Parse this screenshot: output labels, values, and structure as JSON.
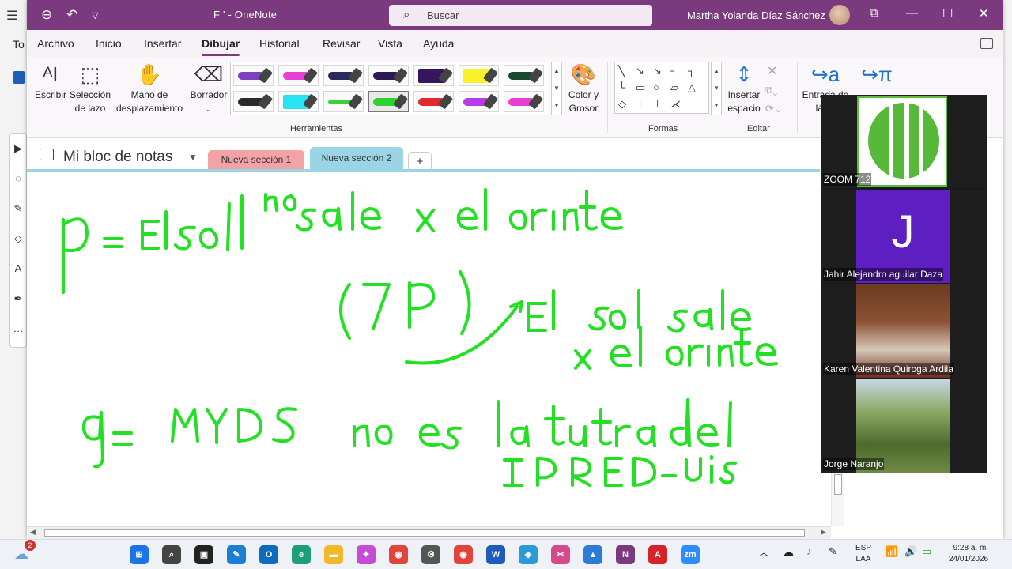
{
  "window": {
    "title": "F ' - OneNote",
    "user_name": "Martha Yolanda Díaz Sánchez",
    "search_placeholder": "Buscar"
  },
  "background_app": {
    "partial_text": "To"
  },
  "menu": {
    "items": [
      "Archivo",
      "Inicio",
      "Insertar",
      "Dibujar",
      "Historial",
      "Revisar",
      "Vista",
      "Ayuda"
    ],
    "active": "Dibujar"
  },
  "ribbon": {
    "escribir": "Escribir",
    "seleccion_1": "Selección",
    "seleccion_2": "de lazo",
    "mano_1": "Mano de",
    "mano_2": "desplazamiento",
    "borrador": "Borrador",
    "color_1": "Color y",
    "color_2": "Grosor",
    "insertar_1": "Insertar",
    "insertar_2": "espacio",
    "entrada_1": "Entrada de",
    "entrada_2": "lápiz",
    "group_herramientas": "Herramientas",
    "group_formas": "Formas",
    "group_editar": "Editar",
    "pen_colors": [
      "#7b3fbf",
      "#e83ed7",
      "#2a2a5c",
      "#2e1a52",
      "#35165c",
      "#f7f22b",
      "#184a30",
      "#2a2a2a",
      "#29e3f2",
      "#3ad13a",
      "#2fd12f",
      "#e3282e",
      "#b63ae8",
      "#e83fd0"
    ],
    "selected_pen_color": "#2fd12f"
  },
  "notebook": {
    "title": "Mi bloc de notas",
    "tabs": [
      {
        "label": "Nueva sección 1",
        "color": "#f3a3a6"
      },
      {
        "label": "Nueva sección 2",
        "color": "#9bd4e4"
      }
    ],
    "add_tab": "+"
  },
  "ink": {
    "color": "#22e022",
    "line1": "p = El sol no sale x el oriente.",
    "line2": "(¬p) El sol sale x el oriente",
    "line3": "q = MYDS no es la tutora del IPRED-UIS"
  },
  "zoom": {
    "participants": [
      {
        "name": "ZOOM 712",
        "tile": "uis-logo"
      },
      {
        "name": "Jahir Alejandro aguilar Daza",
        "initial": "J",
        "color": "#5d1fc2"
      },
      {
        "name": "Karen Valentina Quiroga Ardila",
        "tile": "photo"
      },
      {
        "name": "Jorge Naranjo",
        "tile": "photo"
      }
    ]
  },
  "taskbar": {
    "weather_badge": "2",
    "lang_1": "ESP",
    "lang_2": "LAA",
    "time": "9:28 a. m.",
    "date": "24/01/2026",
    "apps": [
      {
        "icon": "windows-start-icon",
        "color": "#1a73e8",
        "glyph": "⊞"
      },
      {
        "icon": "search-icon",
        "color": "#444444",
        "glyph": "⌕"
      },
      {
        "icon": "task-view-icon",
        "color": "#222222",
        "glyph": "▣"
      },
      {
        "icon": "sticky-notes-icon",
        "color": "#1a7fd4",
        "glyph": "✎"
      },
      {
        "icon": "outlook-icon",
        "color": "#0f6cbd",
        "glyph": "O"
      },
      {
        "icon": "edge-icon",
        "color": "#1da07a",
        "glyph": "e"
      },
      {
        "icon": "file-explorer-icon",
        "color": "#f2b72a",
        "glyph": "▬"
      },
      {
        "icon": "copilot-icon",
        "color": "#c44dd6",
        "glyph": "✦"
      },
      {
        "icon": "chrome-icon",
        "color": "#e0443a",
        "glyph": "◉"
      },
      {
        "icon": "settings-icon",
        "color": "#555555",
        "glyph": "⚙"
      },
      {
        "icon": "chrome-icon",
        "color": "#e0443a",
        "glyph": "◉"
      },
      {
        "icon": "word-icon",
        "color": "#1f5bb8",
        "glyph": "W"
      },
      {
        "icon": "maps-icon",
        "color": "#2c9ad6",
        "glyph": "◈"
      },
      {
        "icon": "snipping-icon",
        "color": "#d44a8c",
        "glyph": "✂"
      },
      {
        "icon": "photos-icon",
        "color": "#2b7bd8",
        "glyph": "▲"
      },
      {
        "icon": "onenote-icon",
        "color": "#7b3a7d",
        "glyph": "N"
      },
      {
        "icon": "acrobat-icon",
        "color": "#d4242a",
        "glyph": "A"
      },
      {
        "icon": "zoom-icon",
        "color": "#2d8cff",
        "glyph": "zm"
      }
    ]
  }
}
